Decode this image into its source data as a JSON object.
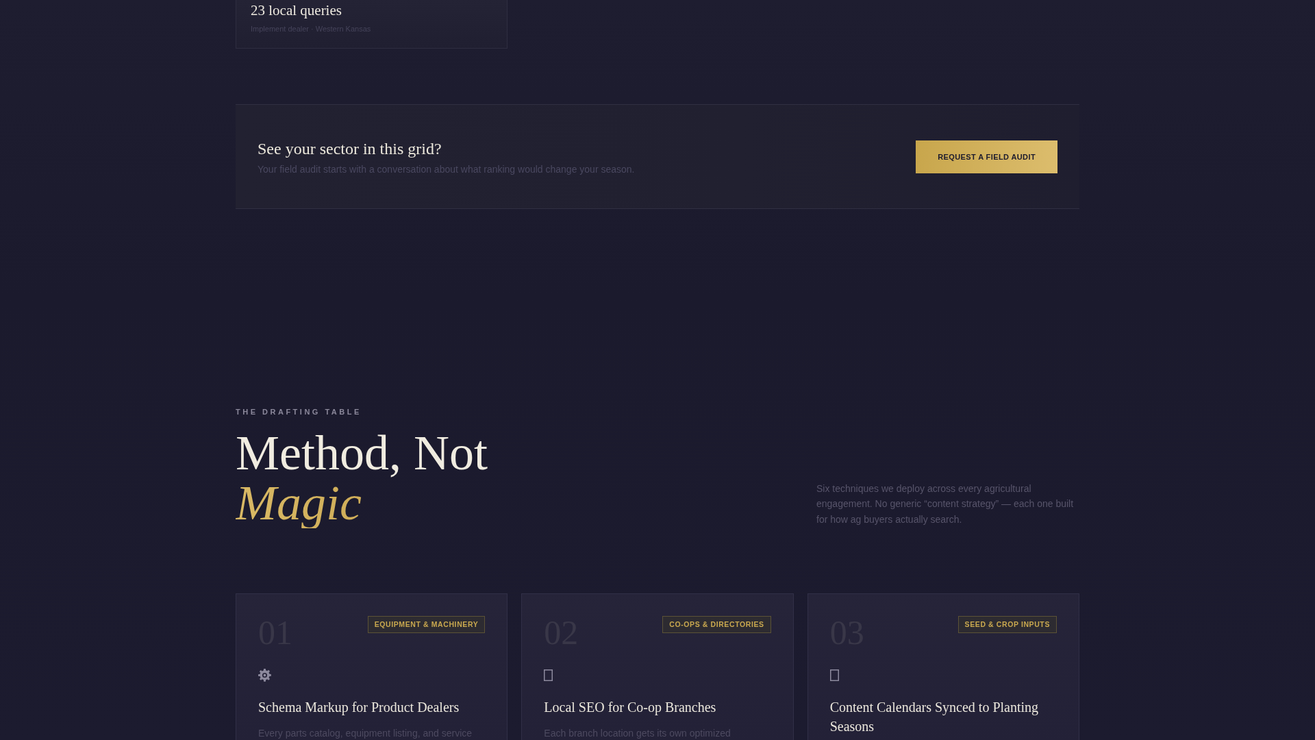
{
  "results_card": {
    "value": "23 local queries",
    "caption": "Implement dealer · Western Kansas"
  },
  "cta": {
    "title": "See your sector in this grid?",
    "text": "Your field audit starts with a conversation about what ranking would change your season.",
    "button": "REQUEST A FIELD AUDIT"
  },
  "section": {
    "eyebrow": "THE DRAFTING TABLE",
    "title": "Method, Not *Magic*",
    "intro": "Six techniques we deploy across every agricultural engagement. No generic “content strategy” — each one built for how ag buyers actually search."
  },
  "cards": [
    {
      "number": "01",
      "tag": "EQUIPMENT & MACHINERY",
      "title": "Schema Markup for Product Dealers",
      "text": "Every parts catalog, equipment listing, and service"
    },
    {
      "number": "02",
      "tag": "CO-OPS & DIRECTORIES",
      "title": "Local SEO for Co-op Branches",
      "text": "Each branch location gets its own optimized"
    },
    {
      "number": "03",
      "tag": "SEED & CROP INPUTS",
      "title": "Content Calendars Synced to Planting Seasons"
    }
  ]
}
